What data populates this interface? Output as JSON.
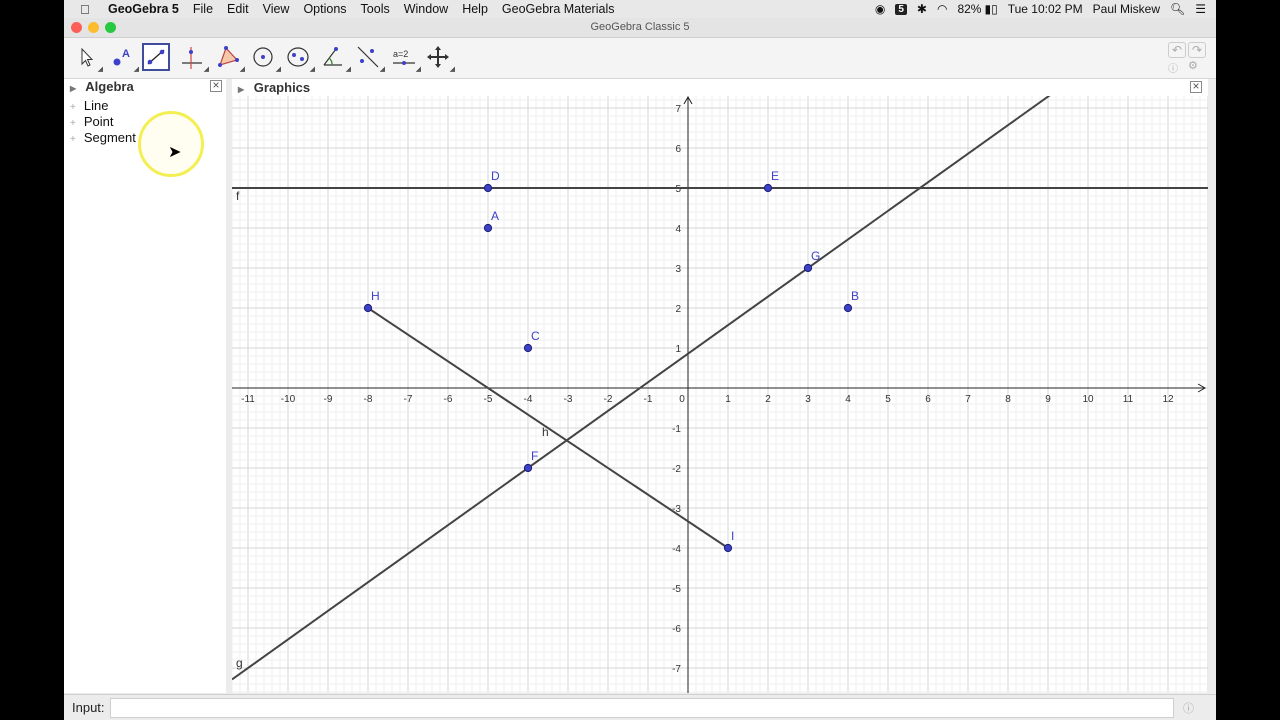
{
  "menubar": {
    "app_name": "GeoGebra 5",
    "items": [
      "File",
      "Edit",
      "View",
      "Options",
      "Tools",
      "Window",
      "Help",
      "GeoGebra Materials"
    ],
    "battery": "82%",
    "clock": "Tue 10:02 PM",
    "user": "Paul Miskew"
  },
  "window": {
    "title": "GeoGebra Classic 5"
  },
  "toolbar": {
    "tools": [
      "move-tool",
      "point-tool",
      "line-tool",
      "perpendicular-line-tool",
      "polygon-tool",
      "circle-tool",
      "ellipse-tool",
      "angle-tool",
      "reflect-tool",
      "slider-tool",
      "move-graphics-view-tool"
    ],
    "selected": "line-tool",
    "slider_label": "a=2"
  },
  "algebra": {
    "title": "Algebra",
    "items": [
      "Line",
      "Point",
      "Segment"
    ]
  },
  "graphics": {
    "title": "Graphics",
    "x_ticks": [
      "-11",
      "-10",
      "-9",
      "-8",
      "-7",
      "-6",
      "-5",
      "-4",
      "-3",
      "-2",
      "-1",
      "0",
      "1",
      "2",
      "3",
      "4",
      "5",
      "6",
      "7",
      "8",
      "9",
      "10",
      "11",
      "12"
    ],
    "y_ticks": [
      "7",
      "6",
      "5",
      "4",
      "3",
      "2",
      "1",
      "-1",
      "-2",
      "-3",
      "-4",
      "-5",
      "-6",
      "-7"
    ],
    "points": [
      {
        "name": "D",
        "x": -5,
        "y": 5
      },
      {
        "name": "E",
        "x": 2,
        "y": 5
      },
      {
        "name": "A",
        "x": -5,
        "y": 4
      },
      {
        "name": "G",
        "x": 3,
        "y": 3
      },
      {
        "name": "B",
        "x": 4,
        "y": 2
      },
      {
        "name": "H",
        "x": -8,
        "y": 2
      },
      {
        "name": "C",
        "x": -4,
        "y": 1
      },
      {
        "name": "F",
        "x": -4,
        "y": -2
      },
      {
        "name": "I",
        "x": 1,
        "y": -4
      }
    ],
    "lines": [
      {
        "name": "f",
        "through": [
          "D",
          "E"
        ]
      },
      {
        "name": "g",
        "through": [
          "F",
          "G"
        ]
      }
    ],
    "segments": [
      {
        "name": "h",
        "from": "H",
        "to": "I"
      }
    ],
    "point_color": "#3d40c9",
    "line_color": "#444444"
  },
  "input": {
    "label": "Input:",
    "value": ""
  }
}
